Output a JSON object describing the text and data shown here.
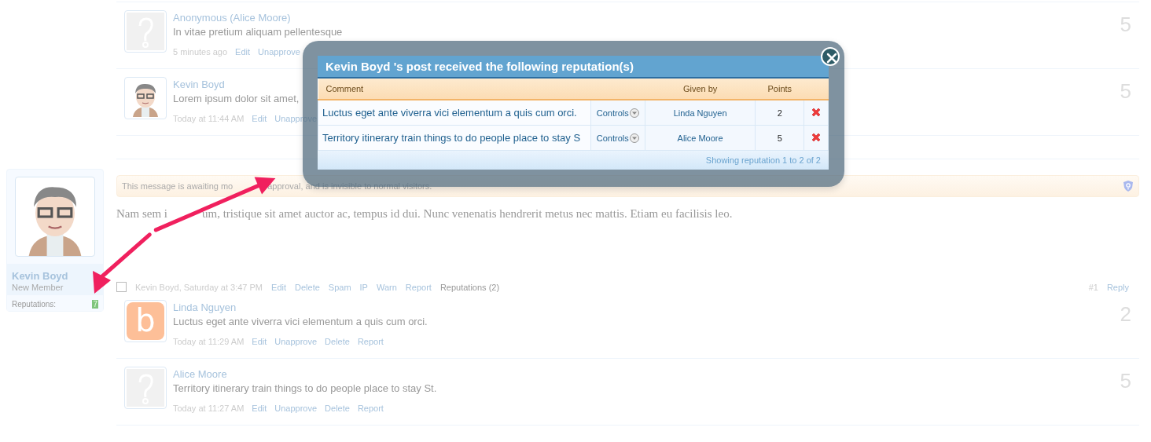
{
  "top_comments": [
    {
      "author": "Anonymous (Alice Moore)",
      "kind": "unknown",
      "text": "In vitae pretium aliquam pellentesque",
      "time": "5 minutes ago",
      "actions": [
        "Edit",
        "Unapprove"
      ],
      "score": "5"
    },
    {
      "author": "Kevin Boyd",
      "kind": "cartoon",
      "text": "Lorem ipsum dolor sit amet,",
      "time": "Today at 11:44 AM",
      "actions": [
        "Edit",
        "Unapprove"
      ],
      "score": "5"
    }
  ],
  "post": {
    "user": {
      "name": "Kevin Boyd",
      "title": "New Member",
      "rep_label": "Reputations:",
      "rep_value": "7"
    },
    "moderation_notice": [
      "This message is awaiting mo",
      "approval, and is invisible to normal visitors."
    ],
    "body": [
      "Nam sem i",
      "um, tristique sit amet auctor ac, tempus id dui. Nunc venenatis hendrerit metus nec mattis. Etiam eu facilisis leo."
    ],
    "footer": {
      "checked": false,
      "meta": "Kevin Boyd, Saturday at 3:47 PM",
      "links": [
        "Edit",
        "Delete",
        "Spam",
        "IP",
        "Warn",
        "Report"
      ],
      "reputations": "Reputations (2)",
      "number": "#1",
      "reply": "Reply"
    },
    "comments": [
      {
        "author": "Linda Nguyen",
        "kind": "letter",
        "letter": "b",
        "text": "Luctus eget ante viverra vici elementum a quis cum orci.",
        "time": "Today at 11:29 AM",
        "actions": [
          "Edit",
          "Unapprove",
          "Delete",
          "Report"
        ],
        "score": "2"
      },
      {
        "author": "Alice Moore",
        "kind": "unknown",
        "text": "Territory itinerary train things to do people place to stay St.",
        "time": "Today at 11:27 AM",
        "actions": [
          "Edit",
          "Unapprove",
          "Delete",
          "Report"
        ],
        "score": "5"
      }
    ]
  },
  "modal": {
    "title": "Kevin Boyd 's post received the following reputation(s)",
    "columns": [
      {
        "label": "Comment"
      },
      {
        "label": "Given by"
      },
      {
        "label": "Points"
      }
    ],
    "rows": [
      {
        "comment": "Luctus eget ante viverra vici elementum a quis cum orci.",
        "control": "Controls",
        "given_by": "Linda Nguyen",
        "points": "2"
      },
      {
        "comment": "Territory itinerary train things to do people place to stay S",
        "control": "Controls",
        "given_by": "Alice Moore",
        "points": "5"
      }
    ],
    "footer": "Showing reputation 1 to 2 of 2"
  }
}
